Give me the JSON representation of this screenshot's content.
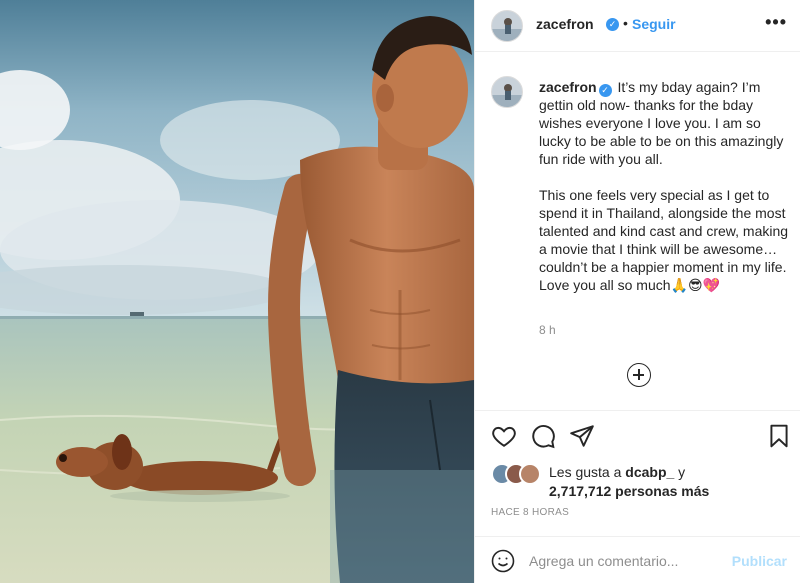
{
  "post": {
    "username": "zacefron",
    "verified_icon": "verified-badge-icon",
    "separator": "•",
    "follow_label": "Seguir",
    "more_icon": "more-options-icon",
    "more_glyph": "•••",
    "caption": "It’s my bday again? I’m gettin old now- thanks for the bday wishes everyone I love you. I am so lucky to be able to be on this amazingly fun ride with you all.\n\nThis one feels very special as I get to spend it in Thailand, alongside the most talented and kind cast and crew, making a movie that I think will be awesome… couldn’t be a happier moment in my life. Love you all so much🙏😎💖",
    "caption_time": "8 h",
    "likes_prefix": "Les gusta a ",
    "likes_user": "dcabp_",
    "likes_join": " y",
    "likes_count_text": "2,717,712 personas más",
    "posted_ago": "HACE 8 HORAS",
    "comment_placeholder": "Agrega un comentario...",
    "publish_label": "Publicar"
  },
  "colors": {
    "link_blue": "#3897f0",
    "publish_disabled": "#b2dffc",
    "muted_text": "#8e8e8e",
    "border": "#efefef"
  },
  "icons": [
    "heart-icon",
    "comment-icon",
    "share-icon",
    "bookmark-icon",
    "add-circle-icon",
    "emoji-icon"
  ]
}
